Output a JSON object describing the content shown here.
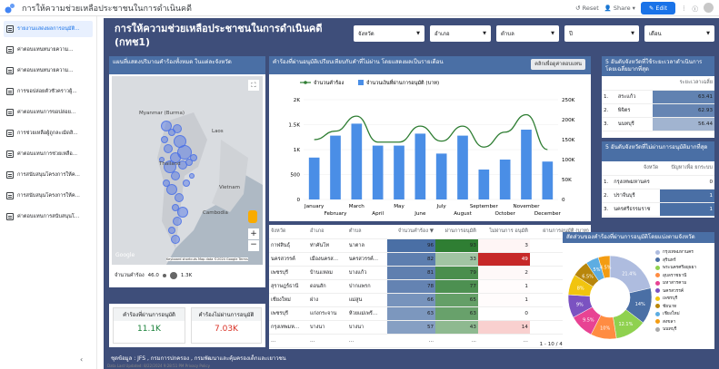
{
  "app": {
    "title": "การให้ความช่วยเหลือประชาชนในการดำเนินคดี",
    "reset": "Reset",
    "share": "Share",
    "edit": "Edit"
  },
  "sidebar": {
    "items": [
      {
        "label": "รายงานแสดงผลการอนุมัติ..."
      },
      {
        "label": "ค่าตอบแทนทนายความ..."
      },
      {
        "label": "ค่าตอบแทนทนายความ..."
      },
      {
        "label": "การขอปล่อยตัวชั่วคราวผู้..."
      },
      {
        "label": "ค่าตอบแทนการขอปล่อย..."
      },
      {
        "label": "การช่วยเหลือผู้ถูกละเมิดสิ..."
      },
      {
        "label": "ค่าตอบแทนการช่วยเหลือ..."
      },
      {
        "label": "การสนับสนุนโครงการให้ค..."
      },
      {
        "label": "การสนับสนุนโครงการให้ค..."
      },
      {
        "label": "ค่าตอบแทนการสนับสนุนโ..."
      }
    ]
  },
  "page": {
    "title": "การให้ความช่วยเหลือประชาชนในการดำเนินคดี (กทช1)"
  },
  "filters": [
    "จังหวัด",
    "อำเภอ",
    "ตำบล",
    "ปี",
    "เดือน"
  ],
  "map": {
    "title": "แผนที่แสดงปริมาณคำร้องทั้งหมด ในแต่ละจังหวัด",
    "labels": [
      {
        "t": "Myanmar (Burma)"
      },
      {
        "t": "Laos"
      },
      {
        "t": "Thailand"
      },
      {
        "t": "Vietnam"
      },
      {
        "t": "Cambodia"
      }
    ],
    "google": "Google",
    "credits": "Keyboard shortcuts   Map data ©2024 Google   Terms",
    "legend_label": "จำนวนคำร้อง",
    "legend_min": "46.0",
    "legend_max": "1.3K"
  },
  "kpis": [
    {
      "label": "คำร้องที่ผ่านการอนุมัติ",
      "value": "11.1K",
      "color": "#188038"
    },
    {
      "label": "คำร้องไม่ผ่านการอนุมัติ",
      "value": "7.03K",
      "color": "#d93025"
    }
  ],
  "combo": {
    "title": "คำร้องที่ผ่านอนุมัติเปรียบเทียบกับคำที่ไม่ผ่าน โดยแสดงผลเป็นรายเดือน",
    "toggle": "คลิกเพื่อดูค่าตอบแทน"
  },
  "chart_data": {
    "type": "bar",
    "categories": [
      "January",
      "February",
      "March",
      "April",
      "May",
      "June",
      "July",
      "August",
      "September",
      "October",
      "November",
      "December"
    ],
    "series": [
      {
        "name": "จำนวนคำร้อง",
        "type": "line",
        "values": [
          1200,
          1370,
          1670,
          1150,
          1150,
          1470,
          1170,
          1470,
          1050,
          1350,
          1700,
          1000
        ],
        "axis": "left"
      },
      {
        "name": "จำนวนเงินที่ผ่านการอนุมัติ (บาท)",
        "type": "bar",
        "values": [
          105000,
          160000,
          190000,
          135000,
          135000,
          165000,
          115000,
          160000,
          75000,
          100000,
          175000,
          95000
        ],
        "axis": "right"
      }
    ],
    "ylim_left": [
      0,
      2000
    ],
    "ylim_right": [
      0,
      250000
    ],
    "left_ticks": [
      "0",
      "500",
      "1K",
      "1.5K",
      "2K"
    ],
    "right_ticks": [
      "0",
      "50K",
      "100K",
      "150K",
      "200K",
      "250K"
    ],
    "legend": "top-left",
    "bar_color": "#4a8ee6",
    "line_color": "#2e7d32"
  },
  "table": {
    "headers": [
      "จังหวัด",
      "อำเภอ",
      "ตำบล",
      "จำนวนคำร้อง ▼",
      "ผ่านการอนุมัติ",
      "ไม่ผ่านการ อนุมัติ",
      "ผ่านการอนุมัติ (บาท)"
    ],
    "rows": [
      [
        "กาฬสินธุ์",
        "ท่าคันโท",
        "นาตาล",
        "96",
        "93",
        "3",
        "326K"
      ],
      [
        "นครสวรรค์",
        "เมืองนครส...",
        "นครสวรรค์...",
        "82",
        "33",
        "49",
        "56.6M"
      ],
      [
        "เพชรบุรี",
        "บ้านแหลม",
        "บางแก้ว",
        "81",
        "79",
        "2",
        "2.4M"
      ],
      [
        "สุราษฎร์ธานี",
        "ดอนสัก",
        "ปากแพรก",
        "78",
        "77",
        "1",
        "1.1M"
      ],
      [
        "เชียงใหม่",
        "ฝาง",
        "แม่สูน",
        "66",
        "65",
        "1",
        "263K"
      ],
      [
        "เพชรบุรี",
        "แก่งกระจาน",
        "ห้วยแม่เพรี...",
        "63",
        "63",
        "0",
        "1.7M"
      ],
      [
        "กรุงเทพมห...",
        "บางนา",
        "บางนา",
        "57",
        "43",
        "14",
        "36.7M"
      ],
      [
        "...",
        "...",
        "...",
        "...",
        "...",
        "...",
        "..."
      ]
    ],
    "pagination": "1 - 10 / 4665"
  },
  "avg_time": {
    "title": "5 อันดับจังหวัดที่ใช้ระยะเวลาดำเนินการโดยเฉลี่ยมากที่สุด",
    "col": "ระยะเวลาเฉลี่ย",
    "rows": [
      [
        "1.",
        "สระแก้ว",
        "63.41"
      ],
      [
        "2.",
        "พิจิตร",
        "62.93"
      ],
      [
        "3.",
        "นนทบุรี",
        "56.44"
      ]
    ]
  },
  "top_reject": {
    "title": "5 อันดับจังหวัดที่ไม่ผ่านการอนุมัติมากที่สุด",
    "col1": "จังหวัด",
    "col2": "ปัญหาเพื่อ ยกระบบ",
    "rows": [
      [
        "1.",
        "กรุงเทพมหานคร",
        "0"
      ],
      [
        "2.",
        "ปราจีนบุรี",
        "1"
      ],
      [
        "3.",
        "นครศรีธรรมราช",
        "1"
      ]
    ]
  },
  "donut": {
    "title": "สัดส่วนของคำร้องที่ผ่านการอนุมัติโดยแบ่งตามจังหวัด",
    "slices": [
      {
        "name": "กรุงเทพมหานคร",
        "value": 21.4,
        "color": "#aebcdf"
      },
      {
        "name": "สุรินทร์",
        "value": 14.0,
        "color": "#4a6fa5"
      },
      {
        "name": "พระนครศรีอยุธยา",
        "value": 12.1,
        "color": "#8fd14f"
      },
      {
        "name": "อุบลราชธานี",
        "value": 10.0,
        "color": "#ff8c42"
      },
      {
        "name": "มหาสารคาม",
        "value": 9.5,
        "color": "#e84393"
      },
      {
        "name": "นครสวรรค์",
        "value": 9.0,
        "color": "#7b52c1"
      },
      {
        "name": "เพชรบุรี",
        "value": 8.0,
        "color": "#f1c40f"
      },
      {
        "name": "ชัยนาท",
        "value": 6.5,
        "color": "#b8860b"
      },
      {
        "name": "เชียงใหม่",
        "value": 5.0,
        "color": "#5dade2"
      },
      {
        "name": "ตาก",
        "value": 4.5,
        "color": "#f39c12"
      }
    ],
    "legend": [
      "กรุงเทพมหานคร",
      "สุรินทร์",
      "พระนครศรีอยุธยา",
      "อุบลราชธานี",
      "มหาสารคาม",
      "นครสวรรค์",
      "เพชรบุรี",
      "ชัยนาท",
      "เชียงใหม่",
      "สงขลา",
      "นนทบุรี"
    ]
  },
  "footer": {
    "source": "ชุดข้อมูล : JFS , กรมการปกครอง , กรมพัฒนาและคุ้มครองเด็กและเยาวชน",
    "updated": "Data Last Updated: 8/22/2024 9:28:51 PM    Privacy Policy"
  }
}
